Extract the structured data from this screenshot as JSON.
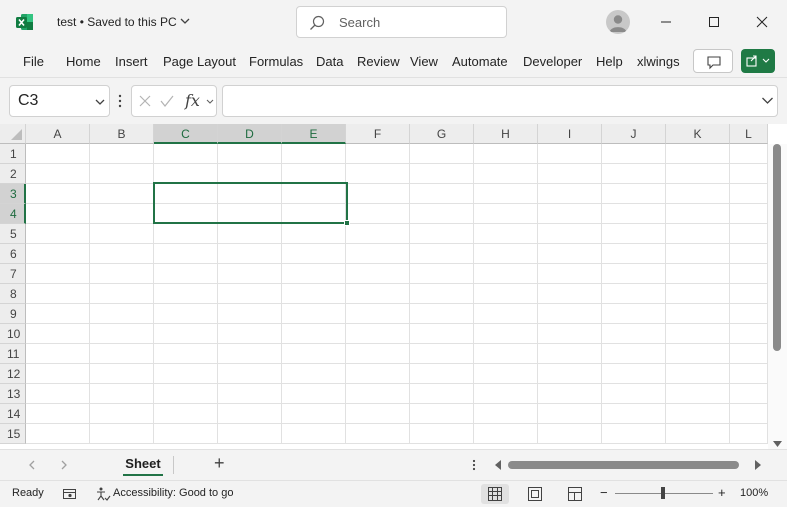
{
  "titlebar": {
    "doc_name": "test",
    "save_status": "Saved to this PC",
    "search_placeholder": "Search"
  },
  "ribbon": {
    "tabs": [
      "File",
      "Home",
      "Insert",
      "Page Layout",
      "Formulas",
      "Data",
      "Review",
      "View",
      "Automate",
      "Developer",
      "Help",
      "xlwings"
    ]
  },
  "formula_bar": {
    "name_box": "C3",
    "fx_label": "fx",
    "formula_value": ""
  },
  "grid": {
    "columns": [
      "A",
      "B",
      "C",
      "D",
      "E",
      "F",
      "G",
      "H",
      "I",
      "J",
      "K",
      "L"
    ],
    "rows": [
      "1",
      "2",
      "3",
      "4",
      "5",
      "6",
      "7",
      "8",
      "9",
      "10",
      "11",
      "12",
      "13",
      "14",
      "15"
    ],
    "selected_columns": [
      "C",
      "D",
      "E"
    ],
    "selected_rows": [
      "3",
      "4"
    ]
  },
  "sheets": {
    "tabs": [
      "Sheet"
    ],
    "active": "Sheet",
    "add_label": "+"
  },
  "status": {
    "mode": "Ready",
    "accessibility": "Accessibility: Good to go",
    "zoom": "100%",
    "minus": "−",
    "plus": "+"
  },
  "colors": {
    "accent": "#217346",
    "chrome": "#f3f3f3"
  }
}
